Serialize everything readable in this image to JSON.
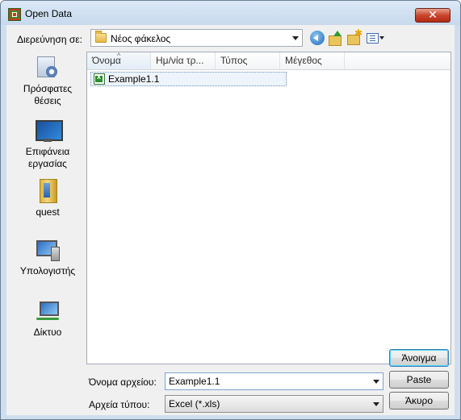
{
  "window": {
    "title": "Open Data",
    "close_label": "✕"
  },
  "lookin": {
    "label": "Διερεύνηση σε:",
    "value": "Νέος φάκελος"
  },
  "toolbar": {
    "icons": [
      "back-icon",
      "up-folder-icon",
      "new-folder-icon",
      "views-menu-icon"
    ]
  },
  "places": [
    {
      "label": "Πρόσφατες θέσεις",
      "icon": "recent-places-icon"
    },
    {
      "label": "Επιφάνεια εργασίας",
      "icon": "desktop-icon"
    },
    {
      "label": "quest",
      "icon": "user-folder-icon"
    },
    {
      "label": "Υπολογιστής",
      "icon": "computer-icon"
    },
    {
      "label": "Δίκτυο",
      "icon": "network-icon"
    }
  ],
  "filelist": {
    "columns": [
      "Όνομα",
      "Ημ/νία τρ...",
      "Τύπος",
      "Μέγεθος"
    ],
    "files": [
      {
        "name": "Example1.1",
        "icon": "excel-file-icon"
      }
    ]
  },
  "filename": {
    "label": "Όνομα αρχείου:",
    "value": "Example1.1"
  },
  "filetype": {
    "label": "Αρχεία τύπου:",
    "value": "Excel (*.xls)"
  },
  "buttons": {
    "open": "Άνοιγμα",
    "paste": "Paste",
    "cancel": "Άκυρο"
  }
}
